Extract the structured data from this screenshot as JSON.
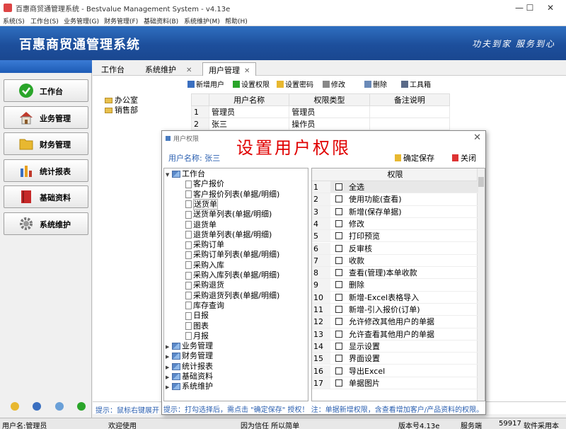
{
  "window": {
    "title": "百惠商贸通管理系统 - Bestvalue Management System - v4.13e",
    "min": "—",
    "max": "☐",
    "close": "✕"
  },
  "menubar": [
    "系统(S)",
    "工作台(S)",
    "业务管理(G)",
    "财务管理(F)",
    "基础资料(B)",
    "系统维护(M)",
    "帮助(H)"
  ],
  "banner": {
    "title": "百惠商贸通管理系统",
    "slogan": "功夫到家 服务到心"
  },
  "nav": [
    {
      "label": "工作台",
      "icon": "check-circle-icon",
      "color": "#2aa52a"
    },
    {
      "label": "业务管理",
      "icon": "house-icon",
      "color": "#c0392b"
    },
    {
      "label": "财务管理",
      "icon": "folder-icon",
      "color": "#e8b830"
    },
    {
      "label": "统计报表",
      "icon": "bar-chart-icon",
      "color": "#3a6fc0"
    },
    {
      "label": "基础资料",
      "icon": "book-icon",
      "color": "#c62828"
    },
    {
      "label": "系统维护",
      "icon": "gear-icon",
      "color": "#777777"
    }
  ],
  "tabs": [
    {
      "label": "工作台",
      "closable": false
    },
    {
      "label": "系统维护",
      "closable": true
    },
    {
      "label": "用户管理",
      "closable": true
    }
  ],
  "toolbar": {
    "add_user": "新增用户",
    "set_permission": "设置权限",
    "set_password": "设置密码",
    "edit": "修改",
    "delete": "删除",
    "toolbox": "工具箱"
  },
  "depts": [
    "办公室",
    "销售部"
  ],
  "user_table": {
    "headers": [
      "用户名称",
      "权限类型",
      "备注说明"
    ],
    "rows": [
      {
        "n": "1",
        "name": "管理员",
        "type": "管理员",
        "note": ""
      },
      {
        "n": "2",
        "name": "张三",
        "type": "操作员",
        "note": ""
      }
    ]
  },
  "hint_main": "提示：鼠标右键展开",
  "dialog": {
    "title": "用户权限",
    "big_title": "设置用户权限",
    "username_label": "用户名称: 张三",
    "confirm_save": "确定保存",
    "close": "关闭",
    "close_x": "✕",
    "grid_header": "权限",
    "hint": "提示：打勾选择后，需点击 \"确定保存\" 授权！ 注：单据新增权限，含查看增加客户/产品资料的权限。"
  },
  "perm_tree": {
    "root": "工作台",
    "children": [
      "客户报价",
      "客户报价列表(单据/明细)",
      "送货单",
      "送货单列表(单据/明细)",
      "退货单",
      "退货单列表(单据/明细)",
      "采购订单",
      "采购订单列表(单据/明细)",
      "采购入库",
      "采购入库列表(单据/明细)",
      "采购退货",
      "采购退货列表(单据/明细)",
      "库存查询",
      "日报",
      "图表",
      "月报"
    ],
    "selected": "送货单",
    "other_roots": [
      "业务管理",
      "财务管理",
      "统计报表",
      "基础资料",
      "系统维护"
    ]
  },
  "permissions": [
    {
      "n": "1",
      "label": "全选"
    },
    {
      "n": "2",
      "label": "使用功能(查看)"
    },
    {
      "n": "3",
      "label": "新增(保存单据)"
    },
    {
      "n": "4",
      "label": "修改"
    },
    {
      "n": "5",
      "label": "打印预览"
    },
    {
      "n": "6",
      "label": "反审核"
    },
    {
      "n": "7",
      "label": "收款"
    },
    {
      "n": "8",
      "label": "查看(管理)本单收款"
    },
    {
      "n": "9",
      "label": "删除"
    },
    {
      "n": "10",
      "label": "新增-Excel表格导入"
    },
    {
      "n": "11",
      "label": "新增-引入报价(订单)"
    },
    {
      "n": "12",
      "label": "允许修改其他用户的单据"
    },
    {
      "n": "13",
      "label": "允许查看其他用户的单据"
    },
    {
      "n": "14",
      "label": "显示设置"
    },
    {
      "n": "15",
      "label": "界面设置"
    },
    {
      "n": "16",
      "label": "导出Excel"
    },
    {
      "n": "17",
      "label": "单据图片"
    }
  ],
  "status": {
    "user": "用户名:管理员",
    "welcome": "欢迎使用",
    "motto": "因为信任 所以简单",
    "version": "版本号4.13e",
    "server": "服务端",
    "count": "59917",
    "tail": "软件采用本"
  }
}
